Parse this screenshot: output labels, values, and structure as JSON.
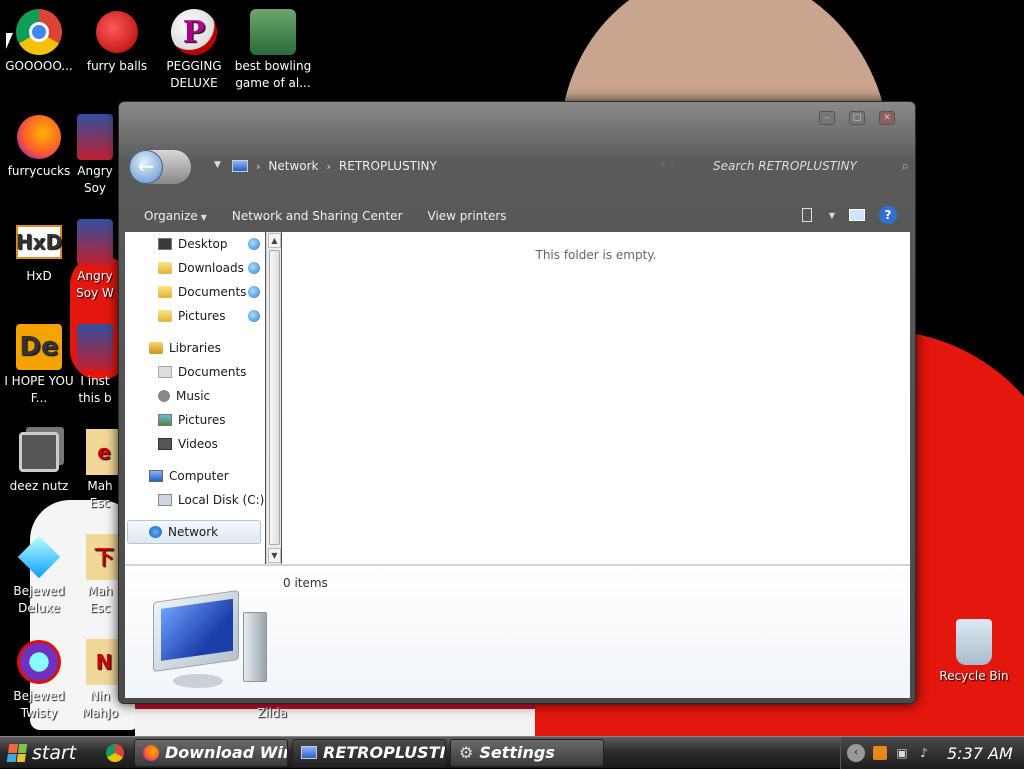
{
  "desktop": {
    "icons": [
      {
        "label": "GOOOOO...",
        "icon": "chrome-icon"
      },
      {
        "label": "furry balls",
        "icon": "furry-balls-icon"
      },
      {
        "label": "PEGGING DELUXE",
        "icon": "pegging-deluxe-icon"
      },
      {
        "label": "best bowling game of al...",
        "icon": "bowling-game-icon"
      },
      {
        "label": "furrycucks",
        "icon": "firefox-icon"
      },
      {
        "label": "Angry Soy",
        "icon": "angry-soy-icon"
      },
      {
        "label": "HxD",
        "icon": "hxd-icon"
      },
      {
        "label": "Angry Soy W",
        "icon": "angry-soy-icon"
      },
      {
        "label": "I HOPE YOU F...",
        "icon": "de-icon"
      },
      {
        "label": "I inst this b",
        "icon": "game-icon"
      },
      {
        "label": "deez nutz",
        "icon": "shortcut-icon"
      },
      {
        "label": "Mah Esc",
        "icon": "mahjong-icon"
      },
      {
        "label": "Bejewed Deluxe",
        "icon": "bejeweled-icon"
      },
      {
        "label": "Mah Esc",
        "icon": "mahjong-icon"
      },
      {
        "label": "Bejewed Twisty",
        "icon": "bejeweled-twist-icon"
      },
      {
        "label": "Nin MahJo",
        "icon": "mahjong-icon"
      },
      {
        "label": "Zilda",
        "icon": "zilda-icon"
      },
      {
        "label": "Recycle Bin",
        "icon": "recycle-bin-icon"
      }
    ]
  },
  "window": {
    "controls": {
      "minimize": "–",
      "maximize": "□",
      "close": "✕"
    },
    "address": {
      "root": "Network",
      "current": "RETROPLUSTINY",
      "sep": "›"
    },
    "search_placeholder": "Search RETROPLUSTINY",
    "toolbar": {
      "organize": "Organize",
      "network_sharing": "Network and Sharing Center",
      "view_printers": "View printers",
      "help": "?"
    },
    "nav": {
      "favorites": [
        {
          "label": "Desktop",
          "icon": "desktop-icon"
        },
        {
          "label": "Downloads",
          "icon": "folder-icon"
        },
        {
          "label": "Documents",
          "icon": "folder-icon"
        },
        {
          "label": "Pictures",
          "icon": "folder-icon"
        }
      ],
      "libraries_label": "Libraries",
      "libraries": [
        {
          "label": "Documents",
          "icon": "documents-icon"
        },
        {
          "label": "Music",
          "icon": "music-icon"
        },
        {
          "label": "Pictures",
          "icon": "pictures-icon"
        },
        {
          "label": "Videos",
          "icon": "videos-icon"
        }
      ],
      "computer_label": "Computer",
      "local_disk": "Local Disk (C:)",
      "network_label": "Network"
    },
    "content": {
      "empty_message": "This folder is empty."
    },
    "details": {
      "items_count": "0 items"
    }
  },
  "taskbar": {
    "start_label": "start",
    "tasks": [
      {
        "label": "Download Win...",
        "icon": "firefox-icon"
      },
      {
        "label": "RETROPLUSTI...",
        "icon": "computer-icon"
      },
      {
        "label": "Settings",
        "icon": "gear-icon"
      }
    ],
    "clock": "5:37 AM"
  }
}
